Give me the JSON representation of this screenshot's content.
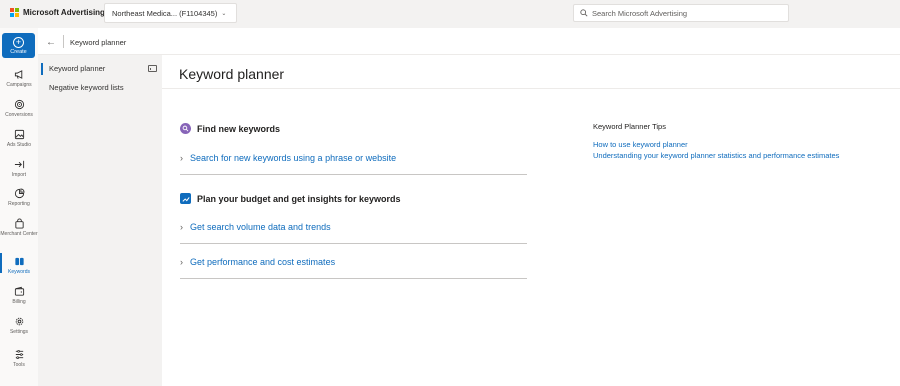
{
  "app": {
    "brand": "Microsoft Advertising",
    "account_label": "Northeast Medica... (F1104345)",
    "search_placeholder": "Search Microsoft Advertising"
  },
  "leftnav": {
    "create_label": "Create",
    "items": [
      {
        "label": "Campaigns",
        "icon": "megaphone-icon"
      },
      {
        "label": "Conversions",
        "icon": "target-icon"
      },
      {
        "label": "Ads Studio",
        "icon": "image-icon"
      },
      {
        "label": "Import",
        "icon": "import-icon"
      },
      {
        "label": "Reporting",
        "icon": "chart-icon"
      },
      {
        "label": "Merchant Center",
        "icon": "shopping-bag-icon"
      },
      {
        "label": "Keywords",
        "icon": "keywords-icon",
        "active": true
      },
      {
        "label": "Billing",
        "icon": "wallet-icon"
      },
      {
        "label": "Settings",
        "icon": "gear-icon"
      },
      {
        "label": "Tools",
        "icon": "tools-icon"
      }
    ]
  },
  "subheader": {
    "title": "Keyword planner"
  },
  "sidepanel": {
    "items": [
      {
        "label": "Keyword planner",
        "active": true
      },
      {
        "label": "Negative keyword lists",
        "active": false
      }
    ]
  },
  "main": {
    "title": "Keyword planner",
    "sections": [
      {
        "heading": "Find new keywords",
        "icon": "search-icon",
        "links": [
          "Search for new keywords using a phrase or website"
        ]
      },
      {
        "heading": "Plan your budget and get insights for keywords",
        "icon": "chart-icon",
        "links": [
          "Get search volume data and trends",
          "Get performance and cost estimates"
        ]
      }
    ],
    "tips": {
      "title": "Keyword Planner Tips",
      "links": [
        "How to use keyword planner",
        "Understanding your keyword planner statistics and performance estimates"
      ]
    }
  },
  "colors": {
    "accent": "#0f6cbd",
    "nav_bg": "#faf9f8",
    "panel_bg": "#f3f2f1"
  }
}
